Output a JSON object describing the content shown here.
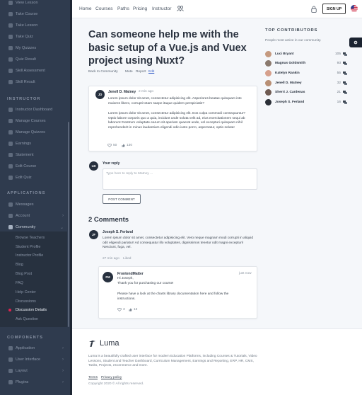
{
  "sidebar": {
    "top_items": [
      "View Lesson",
      "Take Course",
      "Take Lesson",
      "Take Quiz",
      "My Quizzes",
      "Quiz Result",
      "Skill Assessment",
      "Skill Result"
    ],
    "instructor_heading": "INSTRUCTOR",
    "instructor_items": [
      "Instructor Dashboard",
      "Manage Courses",
      "Manage Quizzes",
      "Earnings",
      "Statement",
      "Edit Course",
      "Edit Quiz"
    ],
    "applications_heading": "APPLICATIONS",
    "app_items": [
      {
        "label": "Messages",
        "chevron": ""
      },
      {
        "label": "Account",
        "chevron": "›"
      },
      {
        "label": "Community",
        "chevron": "⌄"
      }
    ],
    "community_sub": [
      "Browse Teachers",
      "Student Profile",
      "Instructor Profile",
      "Blog",
      "Blog Post",
      "FAQ",
      "Help Center",
      "Discussions",
      "Discussion Details",
      "Ask Question"
    ],
    "components_heading": "COMPONENTS",
    "component_items": [
      {
        "label": "Application",
        "chevron": "›"
      },
      {
        "label": "User Interface",
        "chevron": "›"
      },
      {
        "label": "Layout",
        "chevron": "›"
      },
      {
        "label": "Plugins",
        "chevron": "›"
      }
    ]
  },
  "topbar": {
    "links": [
      "Home",
      "Courses",
      "Paths",
      "Pricing",
      "Instructor"
    ],
    "signup_label": "SIGN UP"
  },
  "discussion": {
    "title": "Can someone help me with the basic setup of a Vue.js and Vuex project using Nuxt?",
    "meta": {
      "back": "Back to Community",
      "mute": "Mute",
      "report": "Report",
      "edit": "Edit"
    },
    "question": {
      "initials": "JD",
      "author": "Jenell D. Matney",
      "time": "2 min ago",
      "p1": "Lorem ipsum dolor sit amet, consectetur adipisicing elit. Asperiores beatae quisquam iste maiores libero, corrupti totam saepe itaque quidem perspiciatis?",
      "p2": "Lorem ipsum dolor sit amet, consectetur adipisicing elit. Eos culpa commodi consequuntur? Optio labore corporis quo a quia, incidunt unde soluta velit ad, eius exercitationem sequi ab laborum! Nostrum voluptate earum sit aperiam quaerat unde, vel excepturi quisquam nihil reprehenderit in minus laudantium eligendi odio iusto porro, aspernatur, optio soluta!",
      "likes": "50",
      "views": "130"
    },
    "reply": {
      "initials": "LB",
      "label": "Your reply",
      "placeholder": "Type here to reply to Matney ...",
      "button": "POST COMMENT"
    },
    "comments_heading": "2 Comments",
    "comment": {
      "initials": "JF",
      "author": "Joseph S. Ferland",
      "text": "Lorem ipsum dolor sit amet, consectetur adipisicing elit. Vero neque magnam modi corrupti in aliquid odit eligendi pariatur! Ad consequatur illo voluptates, dignissimos tenetur odit magni excepturi! Nesciunt, fuga, vel.",
      "time": "27 min ago",
      "liked": "Liked"
    },
    "nested": {
      "initials": "FM",
      "author": "FrontendMatter",
      "time": "just now",
      "line1": "Hi Joseph,",
      "line2": "Thank you for purchasing our course!",
      "line3": "Please have a look at the charts library documentation here and follow the instructions.",
      "likes": "3",
      "views": "13"
    }
  },
  "contributors": {
    "heading": "TOP CONTRIBUTORS",
    "subtitle": "People most active in our community.",
    "people": [
      {
        "name": "Luci Bryant",
        "count": "105",
        "color": "#c59a7f"
      },
      {
        "name": "Magnus Goldsmith",
        "count": "93",
        "color": "#8b7a6e"
      },
      {
        "name": "Katelyn Rankin",
        "count": "55",
        "color": "#d6a08c"
      },
      {
        "name": "Jenell D. Matney",
        "count": "32",
        "color": "#b88f74"
      },
      {
        "name": "Sherri J. Cardenas",
        "count": "21",
        "color": "#6f5b52"
      },
      {
        "name": "Joseph S. Ferland",
        "count": "16",
        "color": "#2a2f36"
      }
    ]
  },
  "footer": {
    "brand": "Luma",
    "text": "Luma is a beautifully crafted user interface for modern Education Platforms, including Courses & Tutorials, Video Lessons, Student and Teacher Dashboard, Curriculum Management, Earnings and Reporting, ERP, HR, CMS, Tasks, Projects, eCommerce and more.",
    "terms": "Terms",
    "privacy": "Privacy policy",
    "copyright": "Copyright 2020 © All rights reserved."
  },
  "colors": {
    "sidebar_bg": "#2f3b4e",
    "active_dot": "#e0234f",
    "link": "#3a62c9"
  }
}
